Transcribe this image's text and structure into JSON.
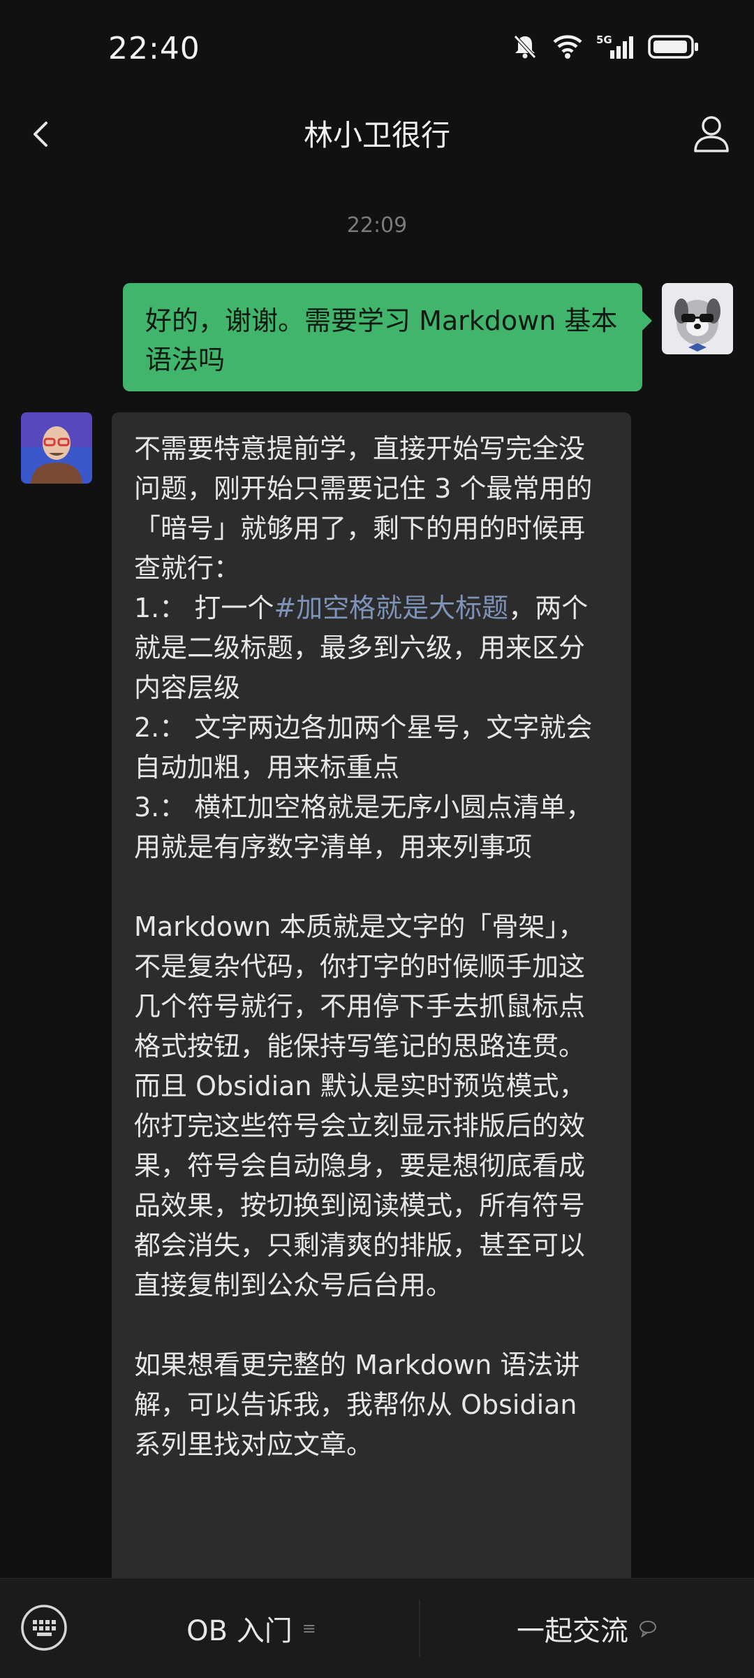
{
  "status_bar": {
    "time": "22:40",
    "icons": [
      "mute-bell-icon",
      "wifi-icon",
      "5g-signal-icon",
      "battery-icon"
    ],
    "network_label": "5G"
  },
  "nav": {
    "title": "林小卫很行",
    "back_icon": "chevron-left-icon",
    "profile_icon": "person-icon"
  },
  "chat": {
    "timestamp": "22:09",
    "sent_message": "好的，谢谢。需要学习 Markdown 基本语法吗",
    "reply": {
      "line_1": "不需要特意提前学，直接开始写完全没问题，刚开始只需要记住 3 个最常用的「暗号」就够用了，剩下的用的时候再查就行：",
      "item_1_prefix": "1.：  打一个",
      "item_1_link": "#加空格就是大标题",
      "item_1_rest": "，两个就是二级标题，最多到六级，用来区分内容层级",
      "item_2": "2.：  文字两边各加两个星号，文字就会自动加粗，用来标重点",
      "item_3": "3.：  横杠加空格就是无序小圆点清单，用就是有序数字清单，用来列事项",
      "paragraph_2": "Markdown 本质就是文字的「骨架」，不是复杂代码，你打字的时候顺手加这几个符号就行，不用停下手去抓鼠标点格式按钮，能保持写笔记的思路连贯。而且 Obsidian 默认是实时预览模式，你打完这些符号会立刻显示排版后的效果，符号会自动隐身，要是想彻底看成品效果，按切换到阅读模式，所有符号都会消失，只剩清爽的排版，甚至可以直接复制到公众号后台用。",
      "paragraph_3": "如果想看更完整的 Markdown 语法讲解，可以告诉我，我帮你从 Obsidian 系列里找对应文章。"
    }
  },
  "bottom_bar": {
    "keyboard_icon": "keyboard-icon",
    "menu_1": "OB 入门",
    "menu_1_icon": "≡",
    "menu_2": "一起交流",
    "menu_2_icon": "💬"
  },
  "colors": {
    "background": "#111111",
    "sent_bubble": "#40b56b",
    "received_bubble": "#2c2c2c",
    "link": "#7d93b8"
  }
}
